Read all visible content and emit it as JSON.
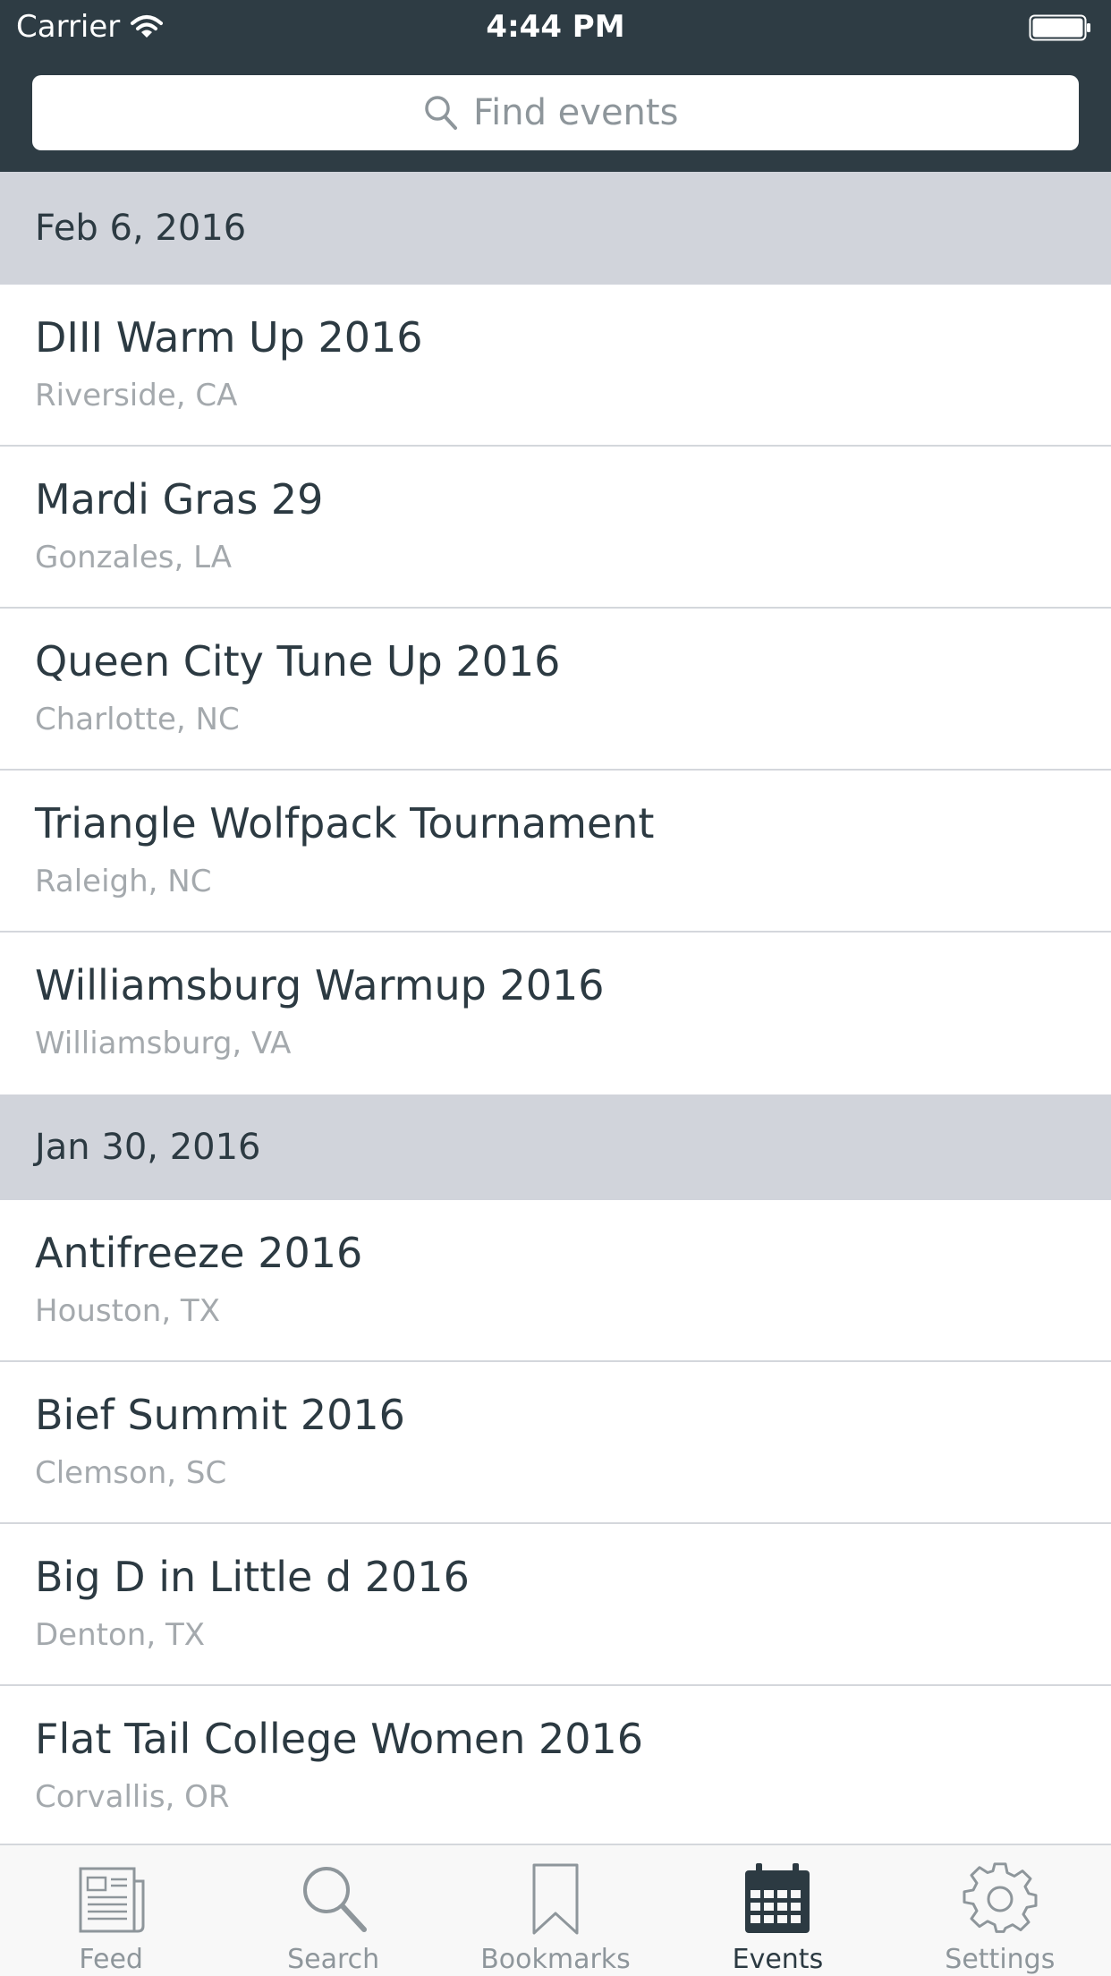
{
  "status_bar": {
    "carrier": "Carrier",
    "time": "4:44 PM"
  },
  "search": {
    "placeholder": "Find events"
  },
  "sections": [
    {
      "date": "Feb 6, 2016",
      "events": [
        {
          "name": "DIII Warm Up 2016",
          "location": "Riverside, CA"
        },
        {
          "name": "Mardi Gras 29",
          "location": "Gonzales, LA"
        },
        {
          "name": "Queen City Tune Up 2016",
          "location": "Charlotte, NC"
        },
        {
          "name": "Triangle Wolfpack Tournament",
          "location": "Raleigh, NC"
        },
        {
          "name": "Williamsburg Warmup 2016",
          "location": "Williamsburg, VA"
        }
      ]
    },
    {
      "date": "Jan 30, 2016",
      "events": [
        {
          "name": "Antifreeze 2016",
          "location": "Houston, TX"
        },
        {
          "name": "Bief Summit 2016",
          "location": "Clemson, SC"
        },
        {
          "name": "Big D in Little d 2016",
          "location": "Denton, TX"
        },
        {
          "name": "Flat Tail College Women 2016",
          "location": "Corvallis, OR"
        }
      ]
    }
  ],
  "tabs": [
    {
      "label": "Feed",
      "icon": "newspaper-icon",
      "active": false
    },
    {
      "label": "Search",
      "icon": "search-icon",
      "active": false
    },
    {
      "label": "Bookmarks",
      "icon": "bookmark-icon",
      "active": false
    },
    {
      "label": "Events",
      "icon": "calendar-icon",
      "active": true
    },
    {
      "label": "Settings",
      "icon": "gear-icon",
      "active": false
    }
  ],
  "colors": {
    "header": "#2e3c44",
    "section_header": "#d1d4db",
    "title_text": "#2c3a42",
    "subtitle_text": "#a4a9ad",
    "tab_inactive": "#8e969b",
    "tab_active": "#2c3a42"
  }
}
